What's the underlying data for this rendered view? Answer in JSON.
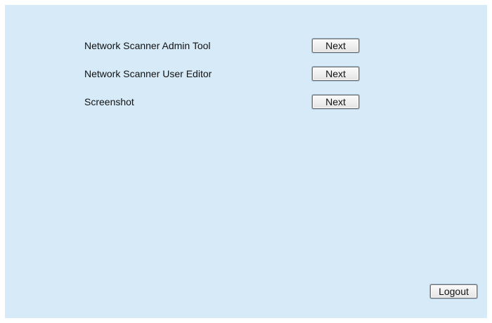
{
  "items": [
    {
      "label": "Network Scanner Admin Tool",
      "button": "Next"
    },
    {
      "label": "Network Scanner User Editor",
      "button": "Next"
    },
    {
      "label": "Screenshot",
      "button": "Next"
    }
  ],
  "footer": {
    "logout_label": "Logout"
  },
  "colors": {
    "panel_background": "#d6eaf8",
    "text": "#111111"
  }
}
